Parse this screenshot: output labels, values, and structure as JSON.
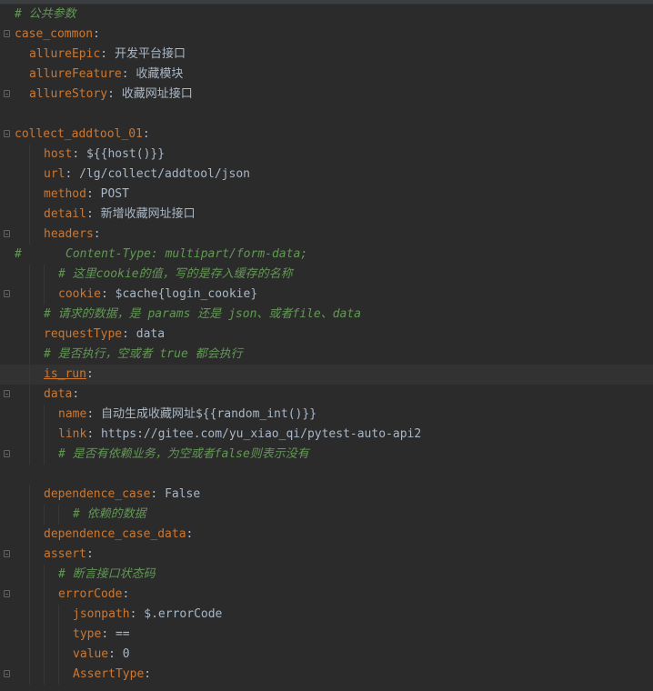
{
  "lines": [
    {
      "type": "comment",
      "indent": 0,
      "text": "# 公共参数"
    },
    {
      "type": "kv",
      "indent": 0,
      "key": "case_common",
      "value": "",
      "fold": true
    },
    {
      "type": "kv",
      "indent": 1,
      "key": "allureEpic",
      "value": "开发平台接口"
    },
    {
      "type": "kv",
      "indent": 1,
      "key": "allureFeature",
      "value": "收藏模块"
    },
    {
      "type": "kv",
      "indent": 1,
      "key": "allureStory",
      "value": "收藏网址接口",
      "fold": true
    },
    {
      "type": "blank"
    },
    {
      "type": "kv",
      "indent": 0,
      "key": "collect_addtool_01",
      "value": "",
      "fold": true
    },
    {
      "type": "kv",
      "indent": 2,
      "key": "host",
      "value": "${{host()}}"
    },
    {
      "type": "kv",
      "indent": 2,
      "key": "url",
      "value": "/lg/collect/addtool/json"
    },
    {
      "type": "kv",
      "indent": 2,
      "key": "method",
      "value": "POST"
    },
    {
      "type": "kv",
      "indent": 2,
      "key": "detail",
      "value": "新增收藏网址接口"
    },
    {
      "type": "kv",
      "indent": 2,
      "key": "headers",
      "value": "",
      "fold": true
    },
    {
      "type": "hashcomment",
      "indent": 0,
      "hash": "#",
      "text": "Content-Type: multipart/form-data;"
    },
    {
      "type": "comment",
      "indent": 3,
      "text": "# 这里cookie的值，写的是存入缓存的名称"
    },
    {
      "type": "kv",
      "indent": 3,
      "key": "cookie",
      "value": "$cache{login_cookie}",
      "fold": true
    },
    {
      "type": "comment",
      "indent": 2,
      "text": "# 请求的数据，是 params 还是 json、或者file、data"
    },
    {
      "type": "kv",
      "indent": 2,
      "key": "requestType",
      "value": "data"
    },
    {
      "type": "comment",
      "indent": 2,
      "text": "# 是否执行，空或者 true 都会执行"
    },
    {
      "type": "kv",
      "indent": 2,
      "key": "is_run",
      "value": "",
      "current": true,
      "underline": true
    },
    {
      "type": "kv",
      "indent": 2,
      "key": "data",
      "value": "",
      "fold": true
    },
    {
      "type": "kv",
      "indent": 3,
      "key": "name",
      "value": "自动生成收藏网址${{random_int()}}"
    },
    {
      "type": "kv",
      "indent": 3,
      "key": "link",
      "value": "https://gitee.com/yu_xiao_qi/pytest-auto-api2"
    },
    {
      "type": "comment",
      "indent": 3,
      "text": "# 是否有依赖业务，为空或者false则表示没有",
      "fold": true
    },
    {
      "type": "blank"
    },
    {
      "type": "kv",
      "indent": 2,
      "key": "dependence_case",
      "value": "False"
    },
    {
      "type": "comment",
      "indent": 4,
      "text": "# 依赖的数据"
    },
    {
      "type": "kv",
      "indent": 2,
      "key": "dependence_case_data",
      "value": ""
    },
    {
      "type": "kv",
      "indent": 2,
      "key": "assert",
      "value": "",
      "fold": true
    },
    {
      "type": "comment",
      "indent": 3,
      "text": "# 断言接口状态码"
    },
    {
      "type": "kv",
      "indent": 3,
      "key": "errorCode",
      "value": "",
      "fold": true
    },
    {
      "type": "kv",
      "indent": 4,
      "key": "jsonpath",
      "value": "$.errorCode"
    },
    {
      "type": "kv",
      "indent": 4,
      "key": "type",
      "value": "=="
    },
    {
      "type": "kv",
      "indent": 4,
      "key": "value",
      "value": "0"
    },
    {
      "type": "kv",
      "indent": 4,
      "key": "AssertType",
      "value": "",
      "fold": true
    }
  ],
  "colors": {
    "background": "#2b2b2b",
    "key": "#cc7832",
    "text": "#a9b7c6",
    "comment": "#629755",
    "current_line": "#323232"
  }
}
